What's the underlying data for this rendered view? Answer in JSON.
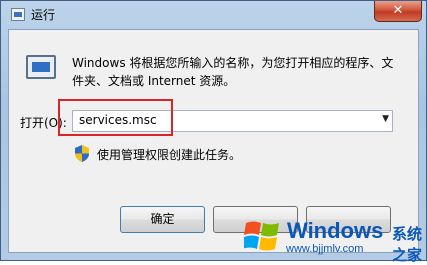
{
  "window": {
    "title": "运行",
    "close_glyph": "✕"
  },
  "dialog": {
    "description": "Windows 将根据您所输入的名称，为您打开相应的程序、文件夹、文档或 Internet 资源。",
    "open_label": "打开(O):",
    "open_value": "services.msc",
    "dropdown_glyph": "▼",
    "admin_note": "使用管理权限创建此任务。"
  },
  "buttons": {
    "ok": "确定",
    "cancel": "",
    "browse": ""
  },
  "watermark": {
    "brand": "Windows",
    "brand_cn": "系统之家",
    "url": "www.bjjmlv.com"
  },
  "colors": {
    "highlight": "#d9252a",
    "accent": "#0a57b7"
  },
  "icons": {
    "app": "run-dialog-icon",
    "close": "close-icon",
    "shield": "uac-shield-icon",
    "logo": "windows-logo-icon"
  }
}
